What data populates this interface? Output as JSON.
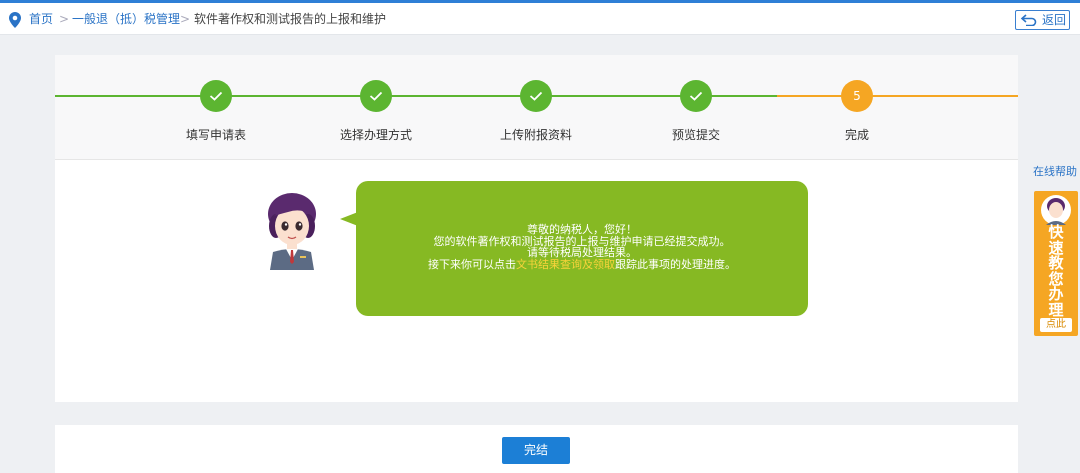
{
  "breadcrumb": {
    "home": "首页",
    "separator": ">",
    "level1": "一般退（抵）税管理",
    "current": "软件著作权和测试报告的上报和维护"
  },
  "header": {
    "back_label": "返回"
  },
  "steps": [
    {
      "label": "填写申请表",
      "status": "done"
    },
    {
      "label": "选择办理方式",
      "status": "done"
    },
    {
      "label": "上传附报资料",
      "status": "done"
    },
    {
      "label": "预览提交",
      "status": "done"
    },
    {
      "label": "完成",
      "status": "current",
      "number": "5"
    }
  ],
  "message": {
    "greeting": "尊敬的纳税人，您好！",
    "line1": "您的软件著作权和测试报告的上报与维护申请已经提交成功。",
    "line2": "请等待税局处理结果。",
    "line3_prefix": "接下来你可以点击",
    "line3_link": "文书结果查询及领取",
    "line3_suffix": "跟踪此事项的处理进度。"
  },
  "footer": {
    "finish_label": "完结"
  },
  "sidebar": {
    "help_label": "在线帮助",
    "quick_chars": [
      "快",
      "速",
      "教",
      "您",
      "办",
      "理"
    ],
    "quick_tag": "点此"
  },
  "colors": {
    "accent_blue": "#2f7fd6",
    "step_done": "#5cb531",
    "step_current": "#f5a623",
    "bubble": "#86b923",
    "highlight": "#f8d33a"
  },
  "icons": [
    "location-pin-icon",
    "return-arrow-icon",
    "check-icon",
    "avatar-icon"
  ]
}
